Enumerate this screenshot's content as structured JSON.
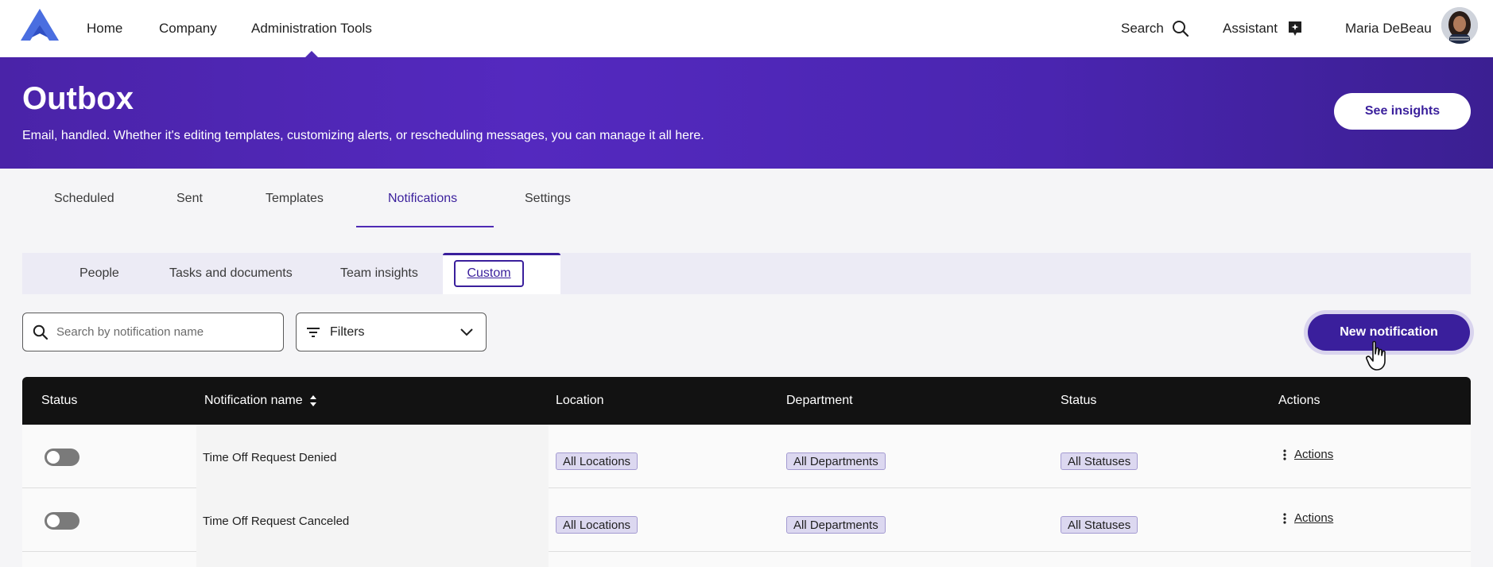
{
  "nav": {
    "home": "Home",
    "company": "Company",
    "admin": "Administration Tools",
    "search": "Search",
    "assistant": "Assistant",
    "user_name": "Maria DeBeau"
  },
  "hero": {
    "title": "Outbox",
    "subtitle": "Email, handled. Whether it's editing templates, customizing alerts, or rescheduling messages, you can manage it all here.",
    "insights_button": "See insights"
  },
  "tabs": {
    "scheduled": "Scheduled",
    "sent": "Sent",
    "templates": "Templates",
    "notifications": "Notifications",
    "settings": "Settings"
  },
  "subtabs": {
    "people": "People",
    "tasks": "Tasks and documents",
    "team": "Team insights",
    "custom": "Custom"
  },
  "controls": {
    "search_placeholder": "Search by notification name",
    "filters_label": "Filters",
    "new_button": "New notification"
  },
  "table": {
    "headers": {
      "status": "Status",
      "name": "Notification name",
      "location": "Location",
      "department": "Department",
      "status2": "Status",
      "actions": "Actions"
    },
    "rows": [
      {
        "name": "Time Off Request Denied",
        "location": "All Locations",
        "department": "All Departments",
        "status": "All Statuses",
        "actions": "Actions"
      },
      {
        "name": "Time Off Request Canceled",
        "location": "All Locations",
        "department": "All Departments",
        "status": "All Statuses",
        "actions": "Actions"
      }
    ]
  },
  "colors": {
    "accent": "#3a1f9c",
    "hero_start": "#4a23a8",
    "header_bg": "#121212"
  }
}
